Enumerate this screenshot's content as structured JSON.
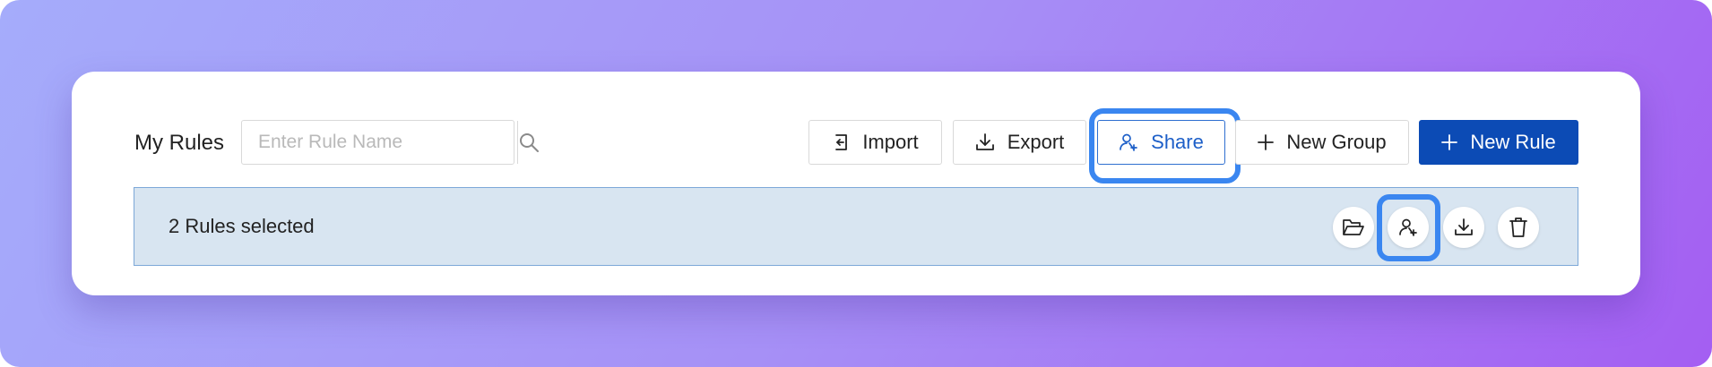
{
  "header": {
    "title": "My Rules",
    "search": {
      "placeholder": "Enter Rule Name",
      "value": ""
    }
  },
  "toolbar": {
    "import_label": "Import",
    "export_label": "Export",
    "share_label": "Share",
    "new_group_label": "New Group",
    "new_rule_label": "New Rule"
  },
  "selection": {
    "text": "2 Rules selected",
    "actions": [
      "folder-open-icon",
      "share-user-icon",
      "download-icon",
      "trash-icon"
    ]
  },
  "colors": {
    "primary": "#0c4bb5",
    "highlight": "#3a86f0",
    "selection_bg": "#d8e5f1"
  }
}
